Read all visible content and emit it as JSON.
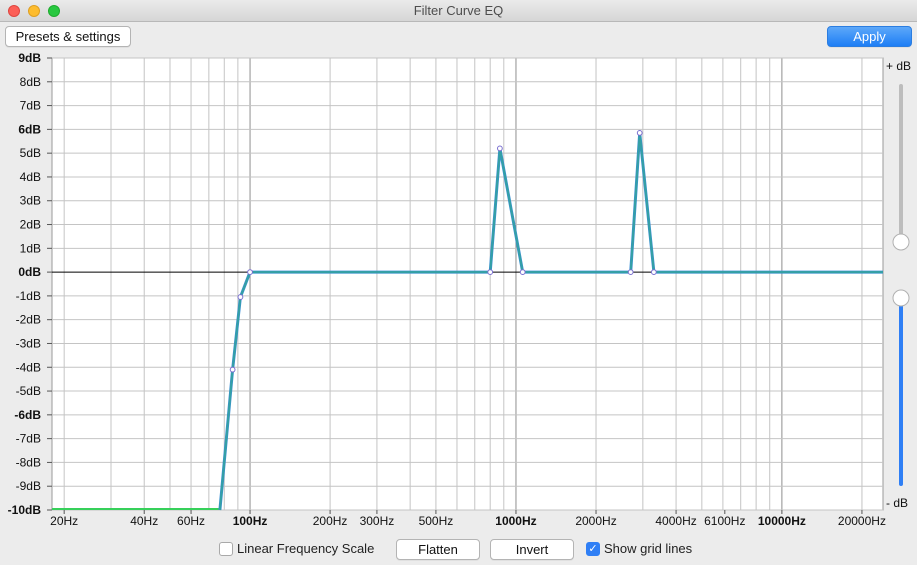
{
  "window": {
    "title": "Filter Curve EQ"
  },
  "toolbar": {
    "presets_label": "Presets & settings",
    "apply_label": "Apply"
  },
  "footer": {
    "linear_scale_label": "Linear Frequency Scale",
    "linear_scale_checked": false,
    "flatten_label": "Flatten",
    "invert_label": "Invert",
    "grid_lines_label": "Show grid lines",
    "grid_lines_checked": true,
    "check_glyph": "✓"
  },
  "sliders": {
    "max_label": "+ dB",
    "min_label": "- dB"
  },
  "colors": {
    "curve": "#34a0a4",
    "curve_outer": "#3a8fd6",
    "flat_green": "#36d05a",
    "control_point": "#7a6fd0",
    "accent": "#1e7ef5"
  },
  "chart_data": {
    "type": "line",
    "x_scale": "log",
    "xlim": [
      18,
      24000
    ],
    "ylim": [
      -10,
      9
    ],
    "grid": true,
    "y_ticks": [
      {
        "value": 9,
        "label": "9dB",
        "bold": true
      },
      {
        "value": 8,
        "label": "8dB",
        "bold": false
      },
      {
        "value": 7,
        "label": "7dB",
        "bold": false
      },
      {
        "value": 6,
        "label": "6dB",
        "bold": true
      },
      {
        "value": 5,
        "label": "5dB",
        "bold": false
      },
      {
        "value": 4,
        "label": "4dB",
        "bold": false
      },
      {
        "value": 3,
        "label": "3dB",
        "bold": false
      },
      {
        "value": 2,
        "label": "2dB",
        "bold": false
      },
      {
        "value": 1,
        "label": "1dB",
        "bold": false
      },
      {
        "value": 0,
        "label": "0dB",
        "bold": true
      },
      {
        "value": -1,
        "label": "-1dB",
        "bold": false
      },
      {
        "value": -2,
        "label": "-2dB",
        "bold": false
      },
      {
        "value": -3,
        "label": "-3dB",
        "bold": false
      },
      {
        "value": -4,
        "label": "-4dB",
        "bold": false
      },
      {
        "value": -5,
        "label": "-5dB",
        "bold": false
      },
      {
        "value": -6,
        "label": "-6dB",
        "bold": true
      },
      {
        "value": -7,
        "label": "-7dB",
        "bold": false
      },
      {
        "value": -8,
        "label": "-8dB",
        "bold": false
      },
      {
        "value": -9,
        "label": "-9dB",
        "bold": false
      },
      {
        "value": -10,
        "label": "-10dB",
        "bold": true
      }
    ],
    "x_ticks": [
      {
        "value": 20,
        "label": "20Hz",
        "bold": false
      },
      {
        "value": 40,
        "label": "40Hz",
        "bold": false
      },
      {
        "value": 60,
        "label": "60Hz",
        "bold": false
      },
      {
        "value": 100,
        "label": "100Hz",
        "bold": true
      },
      {
        "value": 200,
        "label": "200Hz",
        "bold": false
      },
      {
        "value": 300,
        "label": "300Hz",
        "bold": false
      },
      {
        "value": 500,
        "label": "500Hz",
        "bold": false
      },
      {
        "value": 1000,
        "label": "1000Hz",
        "bold": true
      },
      {
        "value": 2000,
        "label": "2000Hz",
        "bold": false
      },
      {
        "value": 4000,
        "label": "4000Hz",
        "bold": false
      },
      {
        "value": 6100,
        "label": "6100Hz",
        "bold": false
      },
      {
        "value": 10000,
        "label": "10000Hz",
        "bold": true
      },
      {
        "value": 20000,
        "label": "20000Hz",
        "bold": false
      }
    ],
    "series": [
      {
        "points": [
          [
            18,
            -10
          ],
          [
            77,
            -10
          ],
          [
            86,
            -4.1
          ],
          [
            92,
            -1.05
          ],
          [
            100,
            0
          ],
          [
            800,
            0
          ],
          [
            870,
            5.2
          ],
          [
            1060,
            0
          ],
          [
            2700,
            0
          ],
          [
            2920,
            5.85
          ],
          [
            3300,
            0
          ],
          [
            24000,
            0
          ]
        ]
      }
    ],
    "control_points": [
      [
        86,
        -4.1
      ],
      [
        92,
        -1.05
      ],
      [
        100,
        0
      ],
      [
        800,
        0
      ],
      [
        870,
        5.2
      ],
      [
        1060,
        0
      ],
      [
        2700,
        0
      ],
      [
        2920,
        5.85
      ],
      [
        3300,
        0
      ]
    ]
  }
}
